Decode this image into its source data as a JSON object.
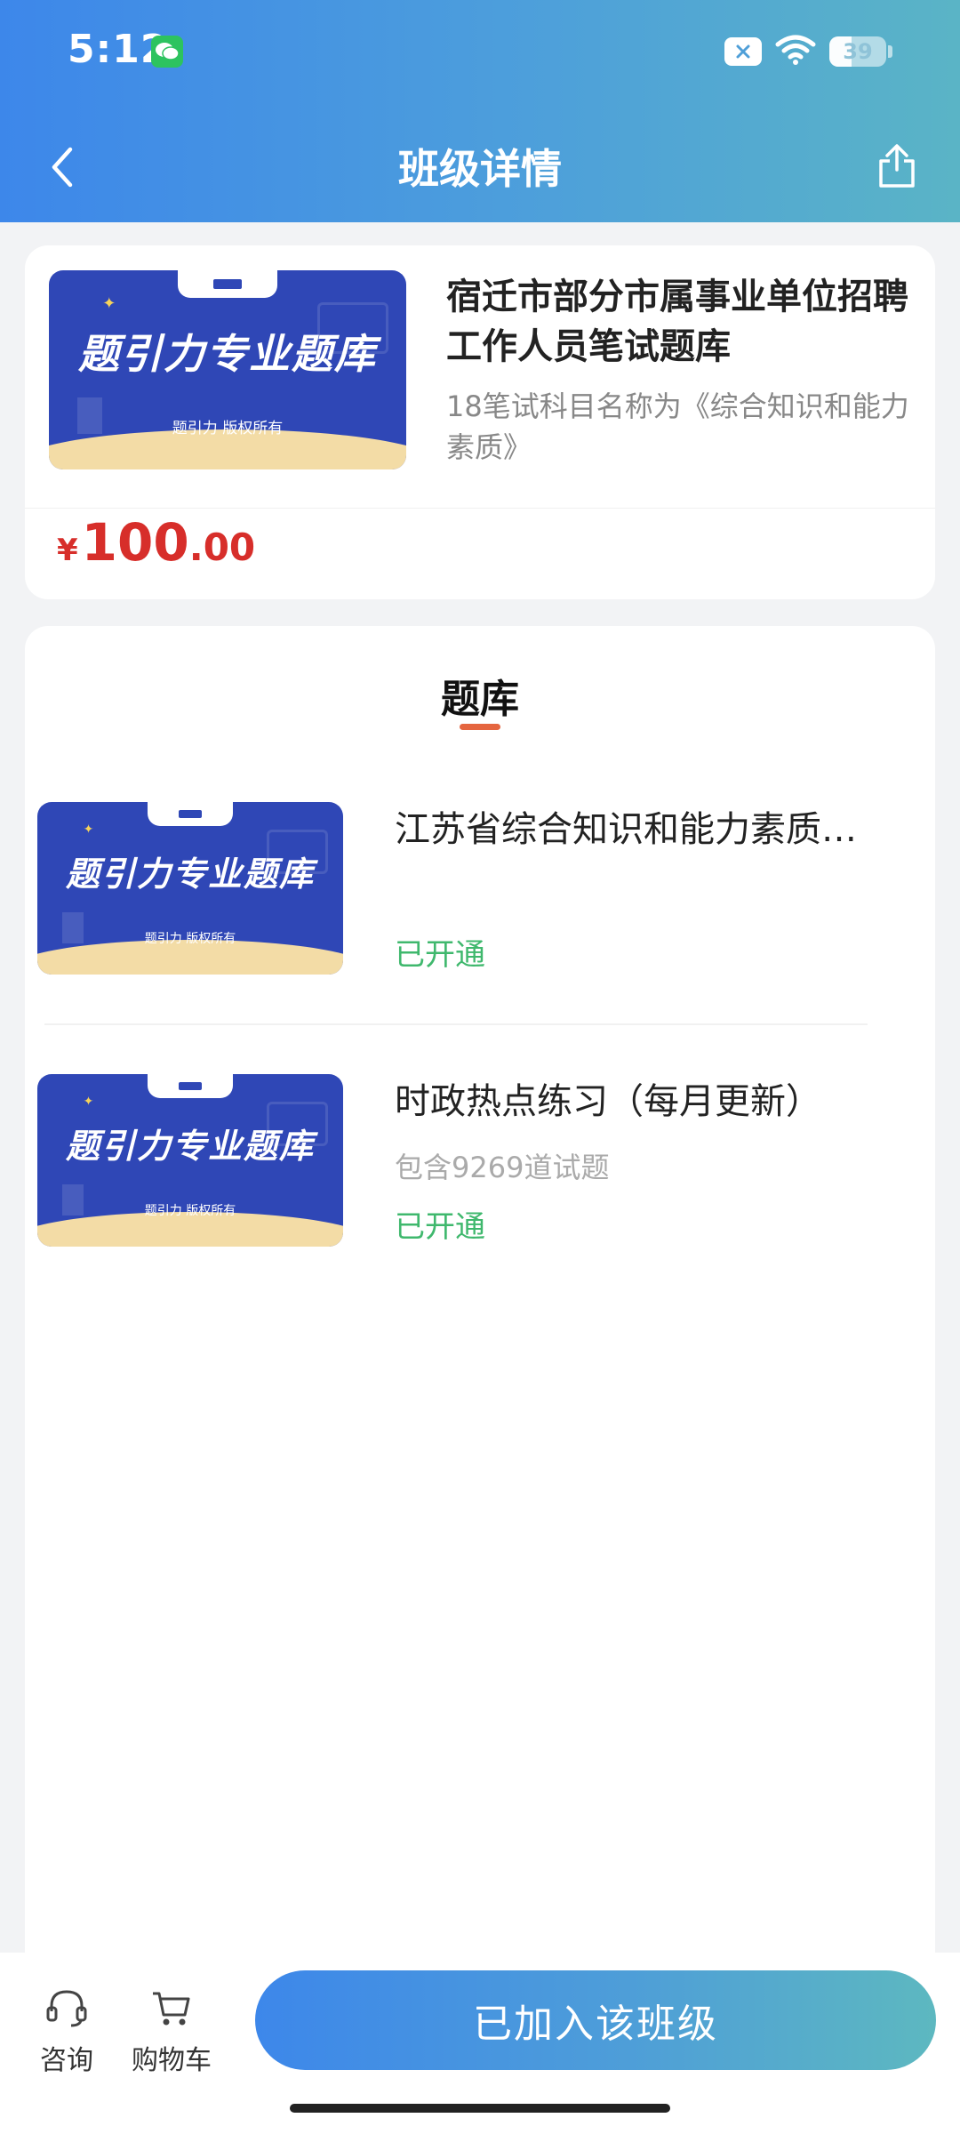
{
  "status_bar": {
    "time": "5:12",
    "battery": "39",
    "battery_level": 0.39,
    "icons": [
      "wechat-icon",
      "close-badge-icon",
      "wifi-icon",
      "battery-icon"
    ]
  },
  "header": {
    "title": "班级详情",
    "back_icon": "chevron-left-icon",
    "share_icon": "share-icon"
  },
  "course": {
    "thumb_title": "题引力专业题库",
    "thumb_footer": "题引力 版权所有",
    "title": "宿迁市部分市属事业单位招聘工作人员笔试题库",
    "description": "18笔试科目名称为《综合知识和能力素质》",
    "price": {
      "currency": "¥",
      "integer": "100",
      "decimal": ".00"
    }
  },
  "section": {
    "title": "题库"
  },
  "banks": [
    {
      "thumb_title": "题引力专业题库",
      "thumb_footer": "题引力 版权所有",
      "title": "江苏省综合知识和能力素质…",
      "subtitle": "",
      "status": "已开通"
    },
    {
      "thumb_title": "题引力专业题库",
      "thumb_footer": "题引力 版权所有",
      "title": "时政热点练习（每月更新）",
      "subtitle": "包含9269道试题",
      "status": "已开通"
    }
  ],
  "bottom_bar": {
    "consult_label": "咨询",
    "cart_label": "购物车",
    "join_label": "已加入该班级"
  },
  "colors": {
    "brand_blue": "#3d87ea",
    "brand_teal": "#5ab4c6",
    "price_red": "#d72e2a",
    "status_green": "#3fb86d",
    "tab_indicator": "#e5653f"
  }
}
